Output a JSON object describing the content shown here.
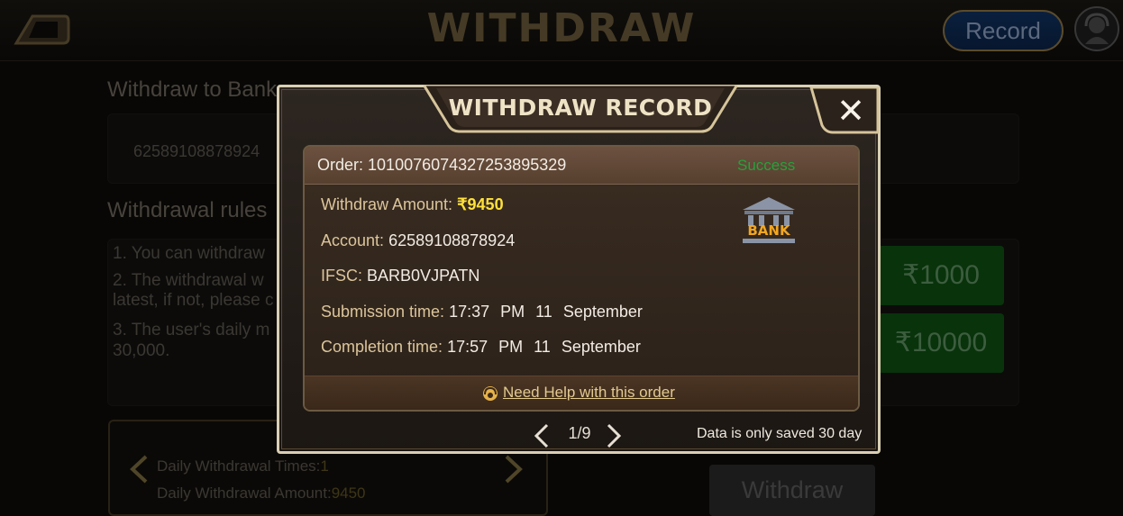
{
  "header": {
    "title": "WITHDRAW",
    "record_label": "Record"
  },
  "background": {
    "withdraw_to_bank_label": "Withdraw to Bank",
    "account_number": "62589108878924",
    "rules_title": "Withdrawal rules",
    "rules": [
      "1. You can withdraw",
      "2. The withdrawal w",
      "latest, if not, please c",
      "3. The user's daily m",
      "30,000."
    ],
    "amount_options": [
      "₹1000",
      "₹10000"
    ],
    "withdraw_button": "Withdraw",
    "daily_times_label": "Daily Withdrawal Times:",
    "daily_times_value": "1",
    "daily_amount_label": "Daily Withdrawal Amount:",
    "daily_amount_value": "9450"
  },
  "modal": {
    "title": "WITHDRAW RECORD",
    "close_icon": "close-icon",
    "order_label": "Order:",
    "order_value": "101007607432725389532​9",
    "status": "Success",
    "withdraw_amount_label": "Withdraw Amount:",
    "withdraw_amount_value": "₹9450",
    "account_label": "Account:",
    "account_value": "62589108878924",
    "ifsc_label": "IFSC:",
    "ifsc_value": "BARB0VJPATN",
    "submission_label": "Submission time:",
    "submission_time": "17:37",
    "submission_ampm": "PM",
    "submission_day": "11",
    "submission_month": "September",
    "completion_label": "Completion time:",
    "completion_time": "17:57",
    "completion_ampm": "PM",
    "completion_day": "11",
    "completion_month": "September",
    "bank_icon_text": "BANK",
    "help_text": "Need Help with this order",
    "pager": "1/9",
    "save_note": "Data is only saved 30 day"
  },
  "colors": {
    "success": "#27a13b",
    "amount": "#ffe13a",
    "gold_label": "#dcc59b",
    "amount_button_green": "#0d4f12"
  }
}
